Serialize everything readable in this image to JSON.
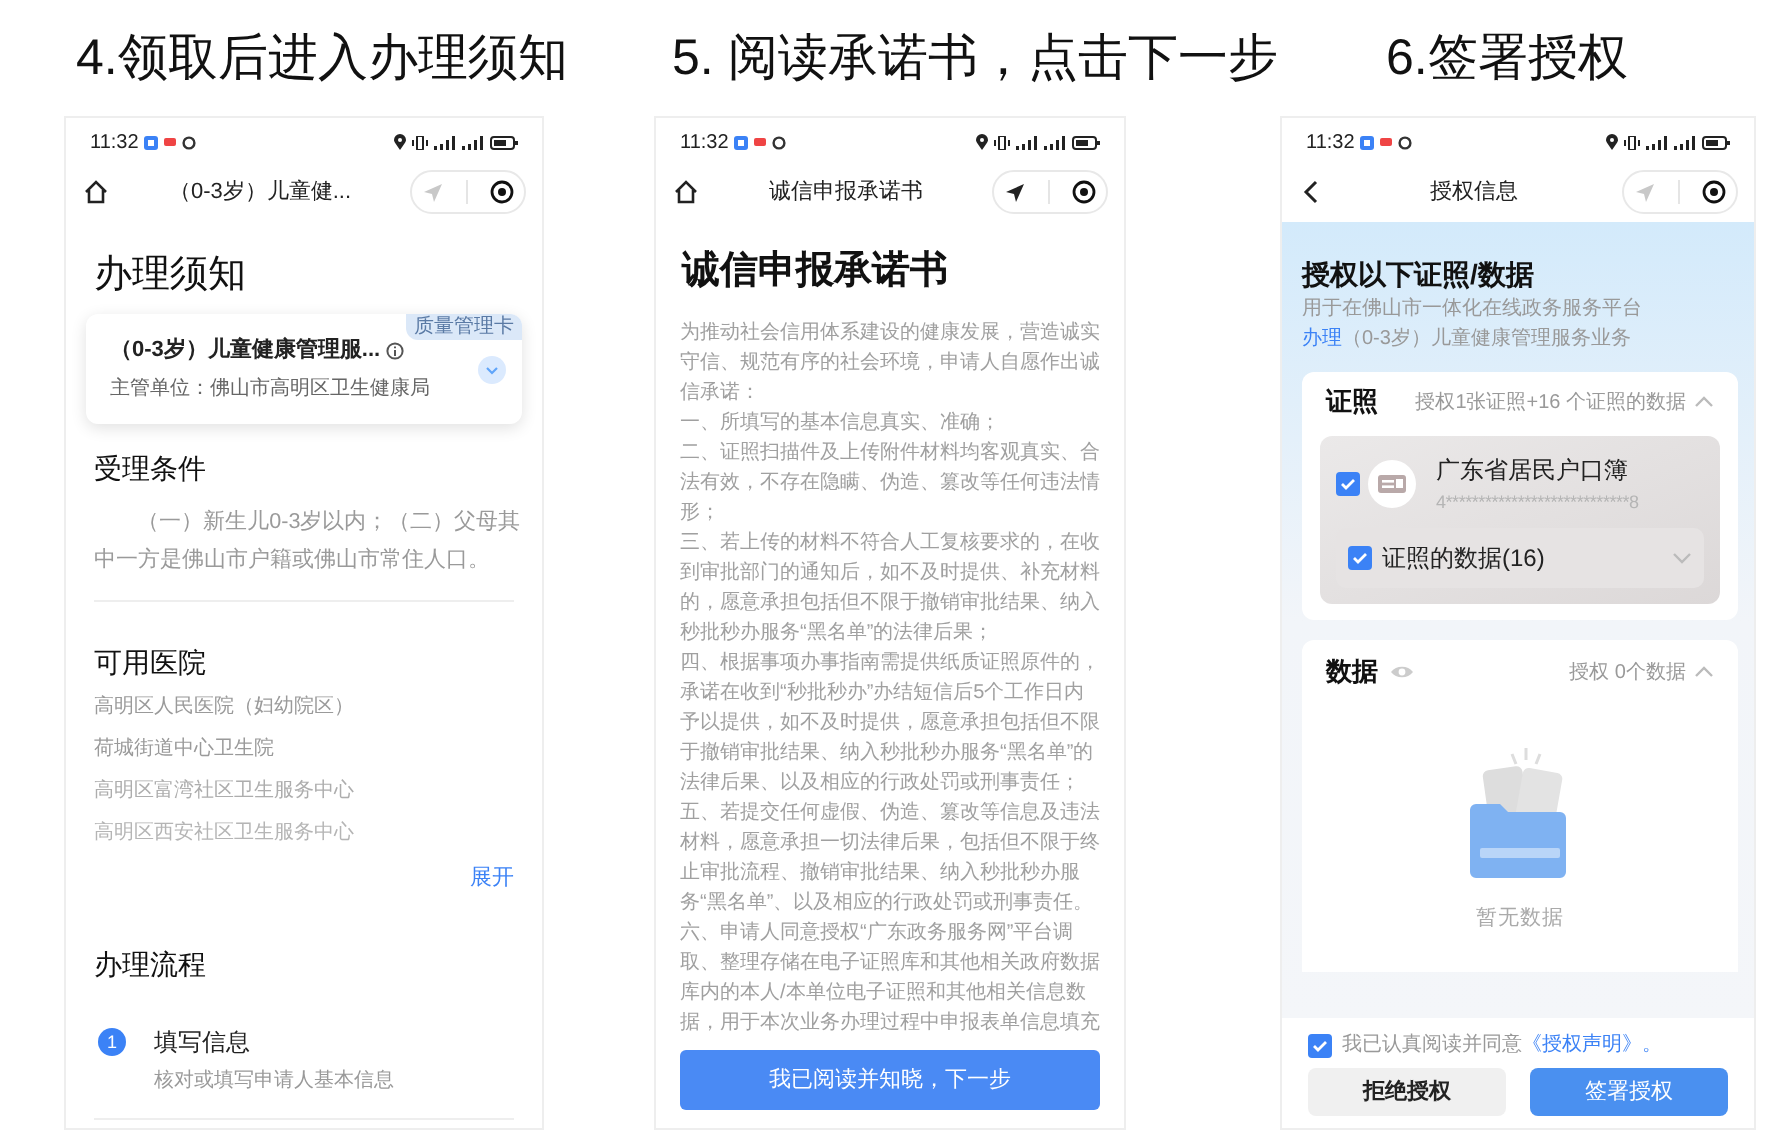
{
  "panels": [
    {
      "kind": "notice",
      "heading": "4.领取后进入办理须知",
      "status_time": "11:32",
      "nav_title": "（0-3岁）儿童健...",
      "title": "办理须知",
      "card": {
        "badge": "质量管理卡",
        "title": "（0-3岁）儿童健康管理服...",
        "department": "主管单位：佛山市高明区卫生健康局"
      },
      "conditions": {
        "heading": "受理条件",
        "text": "（一）新生儿0-3岁以内；（二）父母其中一方是佛山市户籍或佛山市常住人口。"
      },
      "hospitals": {
        "heading": "可用医院",
        "items": [
          "高明区人民医院（妇幼院区）",
          "荷城街道中心卫生院",
          "高明区富湾社区卫生服务中心",
          "高明区西安社区卫生服务中心"
        ],
        "expand_label": "展开"
      },
      "process": {
        "heading": "办理流程",
        "steps": [
          {
            "number": "1",
            "title": "填写信息",
            "desc": "核对或填写申请人基本信息"
          }
        ]
      }
    },
    {
      "kind": "pledge",
      "heading": "5. 阅读承诺书，点击下一步",
      "status_time": "11:32",
      "nav_title": "诚信申报承诺书",
      "title": "诚信申报承诺书",
      "paragraphs": [
        "为推动社会信用体系建设的健康发展，营造诚实守信、规范有序的社会环境，申请人自愿作出诚信承诺：",
        "一、所填写的基本信息真实、准确；",
        "二、证照扫描件及上传附件材料均客观真实、合法有效，不存在隐瞒、伪造、篡改等任何违法情形；",
        "三、若上传的材料不符合人工复核要求的，在收到审批部门的通知后，如不及时提供、补充材料的，愿意承担包括但不限于撤销审批结果、纳入秒批秒办服务“黑名单”的法律后果；",
        "四、根据事项办事指南需提供纸质证照原件的，承诺在收到“秒批秒办”办结短信后5个工作日内予以提供，如不及时提供，愿意承担包括但不限于撤销审批结果、纳入秒批秒办服务“黑名单”的法律后果、以及相应的行政处罚或刑事责任；",
        "五、若提交任何虚假、伪造、篡改等信息及违法材料，愿意承担一切法律后果，包括但不限于终止审批流程、撤销审批结果、纳入秒批秒办服务“黑名单”、以及相应的行政处罚或刑事责任。",
        "六、申请人同意授权“广东政务服务网”平台调取、整理存储在电子证照库和其他相关政府数据库内的本人/本单位电子证照和其他相关信息数据，用于本次业务办理过程中申报表单信息填充"
      ],
      "button": "我已阅读并知晓，下一步"
    },
    {
      "kind": "authorization",
      "heading": "6.签署授权",
      "status_time": "11:32",
      "nav_title": "授权信息",
      "title": "授权以下证照/数据",
      "subtitle": "用于在佛山市一体化在线政务服务平台",
      "purpose_action": "办理",
      "purpose_text": "（0-3岁）儿童健康管理服务业务",
      "licenses": {
        "heading": "证照",
        "summary": "授权1张证照+16 个证照的数据",
        "items": [
          {
            "name": "广东省居民户口簿",
            "number": "4****************************8",
            "checked": true,
            "data_label": "证照的数据(16)",
            "data_checked": true
          }
        ]
      },
      "data_section": {
        "heading": "数据",
        "summary": "授权 0个数据",
        "empty_text": "暂无数据"
      },
      "agreement": {
        "checked": true,
        "text": "我已认真阅读并同意",
        "link": "《授权声明》",
        "end": "。"
      },
      "reject_button": "拒绝授权",
      "sign_button": "签署授权"
    }
  ]
}
